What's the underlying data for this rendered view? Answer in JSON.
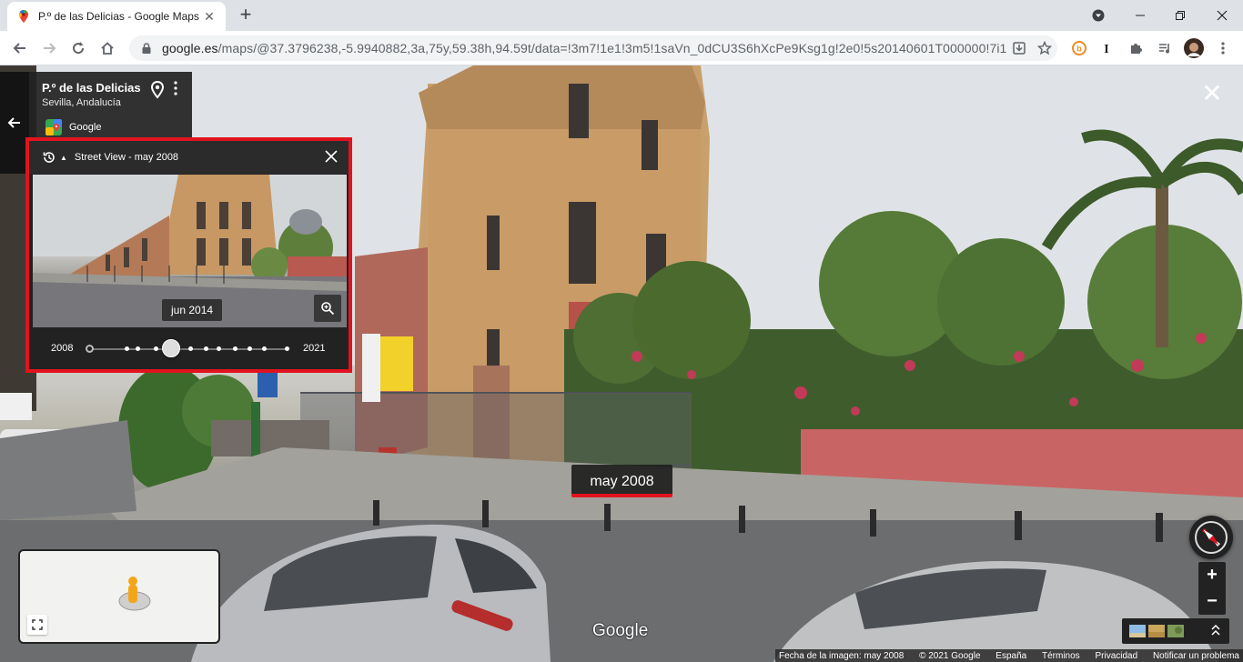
{
  "browser": {
    "tab": {
      "title": "P.º de las Delicias - Google Maps",
      "close_glyph": "✕"
    },
    "new_tab_glyph": "+",
    "window_controls": [
      "⌄",
      "—",
      "❐",
      "✕"
    ],
    "url_host": "google.es",
    "url_rest": "/maps/@37.3796238,-5.9940882,3a,75y,59.38h,94.59t/data=!3m7!1e1!3m5!1saVn_0dCU3S6hXcPe9Ksg1g!2e0!5s20140601T000000!7i1331...",
    "icons": [
      "back-icon",
      "forward-icon",
      "reload-icon",
      "home-icon",
      "lock-icon",
      "install-icon",
      "star-icon",
      "extension-icons",
      "profile-avatar"
    ]
  },
  "place": {
    "title": "P.º de las Delicias",
    "subtitle": "Sevilla, Andalucía",
    "provider": "Google"
  },
  "history_panel": {
    "title": "Street View - may 2008",
    "thumb_date": "jun 2014",
    "year_start": "2008",
    "year_end": "2021",
    "timeline_points": 12,
    "selected_index": 3
  },
  "scene": {
    "date_label": "may 2008",
    "watermark": "Google"
  },
  "controls": {
    "zoom_in": "+",
    "zoom_out": "−",
    "close": "✕"
  },
  "footer": {
    "image_date": "Fecha de la imagen: may 2008",
    "copyright": "© 2021 Google",
    "country": "España",
    "terms": "Términos",
    "privacy": "Privacidad",
    "report": "Notificar un problema"
  },
  "colors": {
    "highlight_red": "#e2131e",
    "panel_dark": "#222222",
    "chrome_tabstrip": "#dee1e6"
  }
}
